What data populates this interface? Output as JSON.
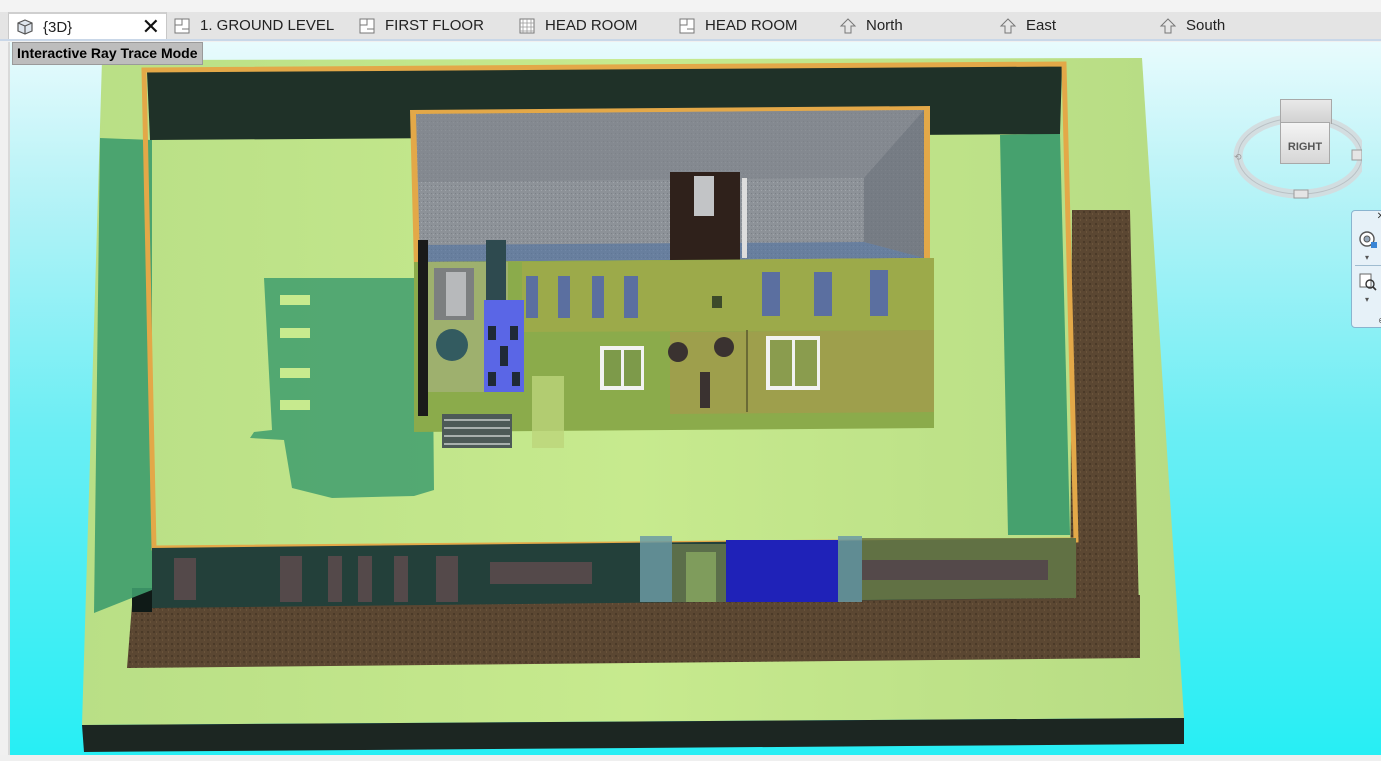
{
  "tabs": [
    {
      "label": "{3D}",
      "icon": "3d-view-icon",
      "active": true
    },
    {
      "label": "1. GROUND LEVEL",
      "icon": "floor-plan-icon"
    },
    {
      "label": "FIRST FLOOR",
      "icon": "floor-plan-icon"
    },
    {
      "label": "HEAD ROOM",
      "icon": "ceiling-plan-icon"
    },
    {
      "label": "HEAD ROOM",
      "icon": "floor-plan-icon"
    },
    {
      "label": "North",
      "icon": "elevation-icon"
    },
    {
      "label": "East",
      "icon": "elevation-icon"
    },
    {
      "label": "South",
      "icon": "elevation-icon"
    }
  ],
  "close_icon": "close-icon",
  "viewport": {
    "mode_label": "Interactive Ray Trace Mode"
  },
  "viewcube": {
    "face_label": "RIGHT"
  },
  "colors": {
    "sky_top": "#e8fbfd",
    "sky_bottom": "#27eef4",
    "grass": "#bfe68a",
    "wall_frame": "#e2a94a",
    "earth": "#5a4630",
    "roof": "#8a8f96"
  }
}
